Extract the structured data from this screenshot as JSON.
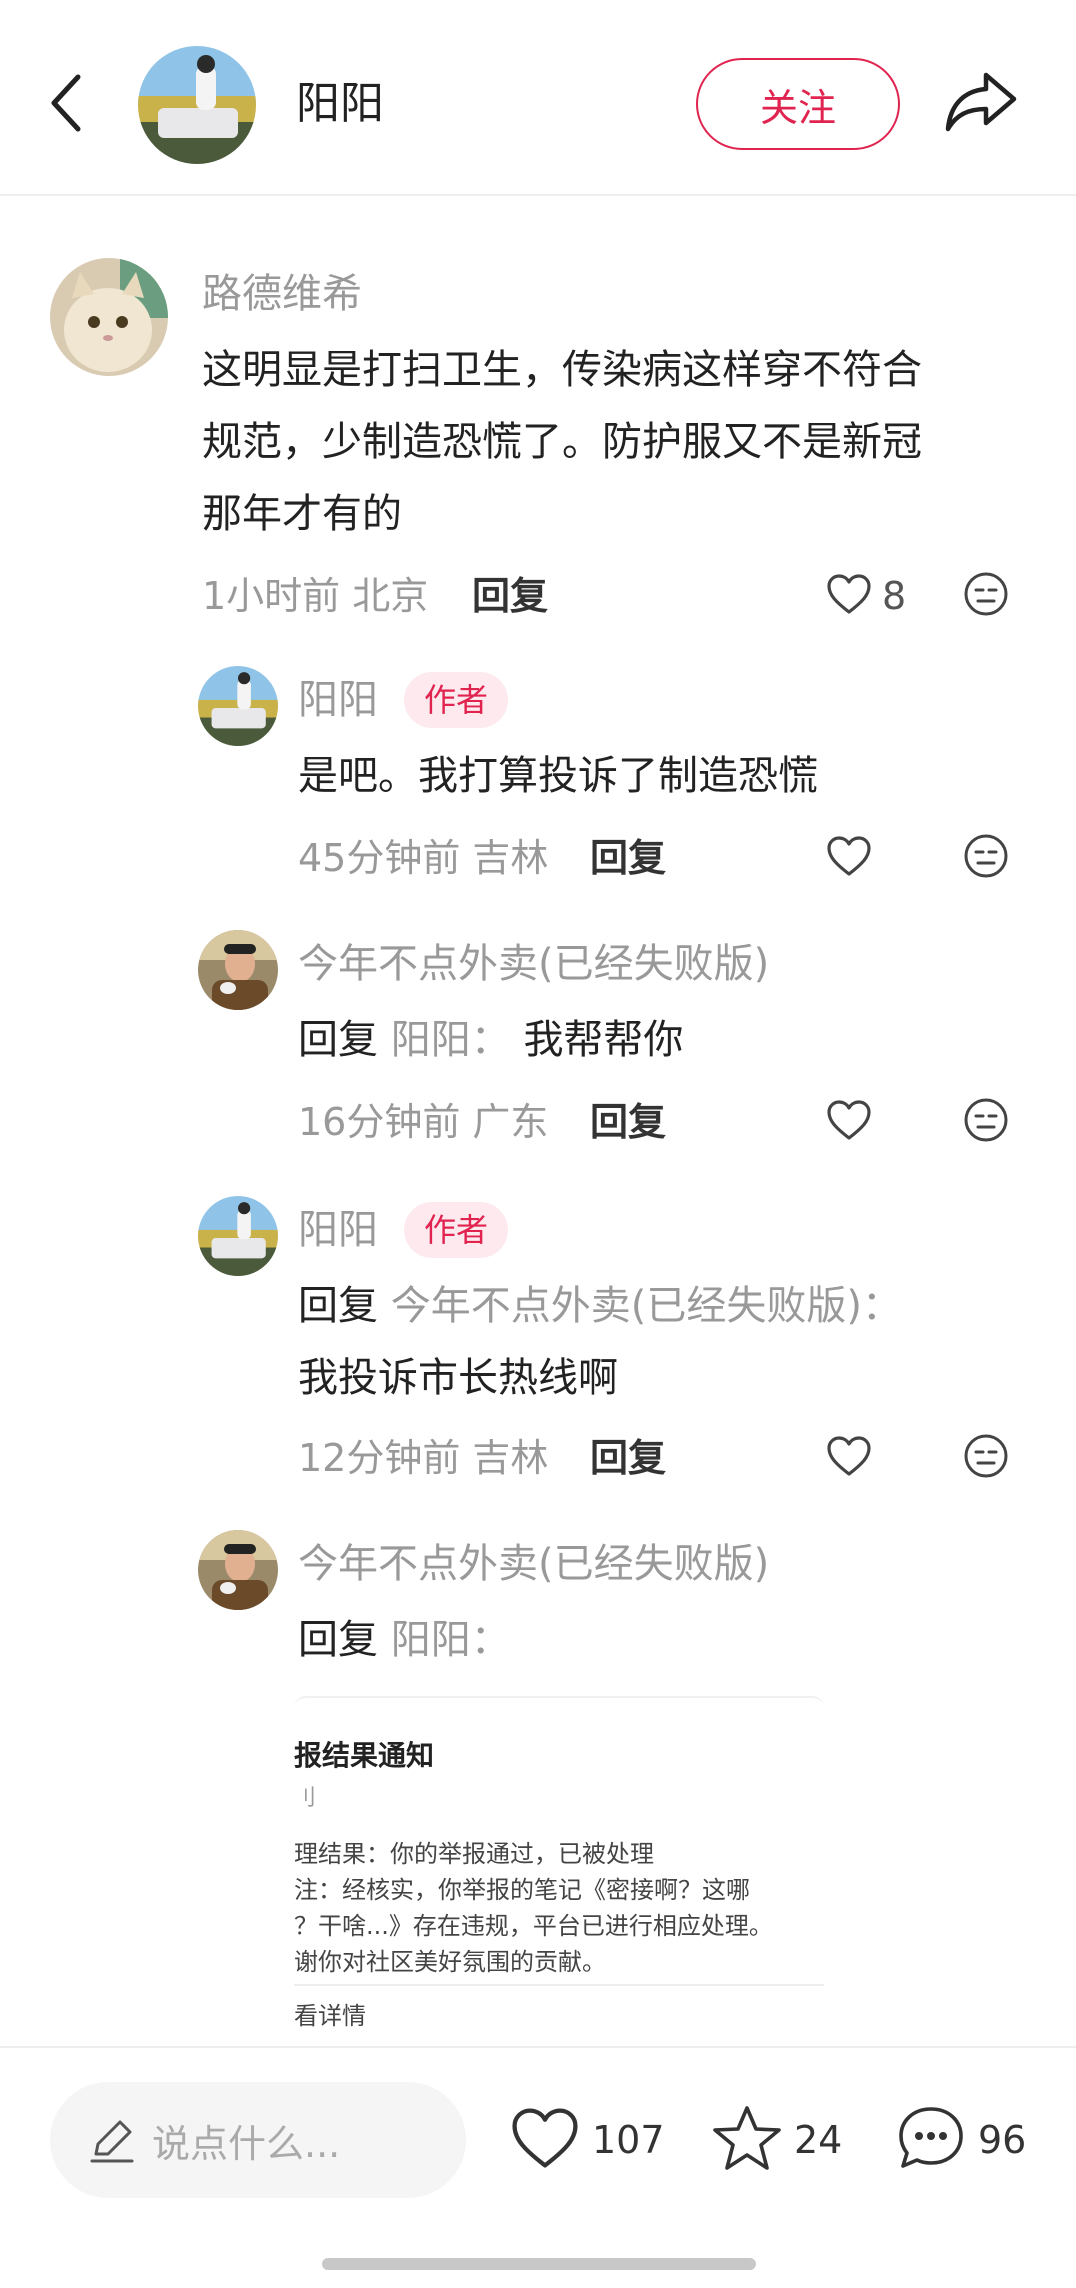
{
  "header": {
    "name": "阳阳",
    "follow_label": "关注"
  },
  "comments": [
    {
      "name": "路德维希",
      "lines": [
        "这明显是打扫卫生，传染病这样穿不符合",
        "规范，少制造恐慌了。防护服又不是新冠",
        "那年才有的"
      ],
      "time_location": "1小时前 北京",
      "reply_label": "回复",
      "likes": "8"
    },
    {
      "name": "阳阳",
      "tag": "作者",
      "text": "是吧。我打算投诉了制造恐慌",
      "time_location": "45分钟前 吉林",
      "reply_label": "回复"
    },
    {
      "name": "今年不点外卖(已经失败版)",
      "reply_prefix": "回复",
      "reply_target": "阳阳：",
      "text": "我帮帮你",
      "time_location": "16分钟前 广东",
      "reply_label": "回复"
    },
    {
      "name": "阳阳",
      "tag": "作者",
      "reply_prefix": "回复",
      "reply_target": "今年不点外卖(已经失败版)：",
      "text": "我投诉市长热线啊",
      "time_location": "12分钟前 吉林",
      "reply_label": "回复"
    },
    {
      "name": "今年不点外卖(已经失败版)",
      "reply_prefix": "回复",
      "reply_target": "阳阳："
    }
  ],
  "report_image": {
    "title": "报结果通知",
    "subtitle": "刂",
    "lines": [
      "理结果：你的举报通过，已被处理",
      "注：经核实，你举报的笔记《密接啊？这哪",
      "？干啥...》存在违规，平台已进行相应处理。",
      "谢你对社区美好氛围的贡献。"
    ],
    "detail_link": "看详情"
  },
  "bottom_bar": {
    "input_placeholder": "说点什么...",
    "likes": "107",
    "stars": "24",
    "comments": "96"
  },
  "colors": {
    "accent": "#e0244f",
    "muted_text": "#999999",
    "tag_bg": "#fde9ee"
  }
}
